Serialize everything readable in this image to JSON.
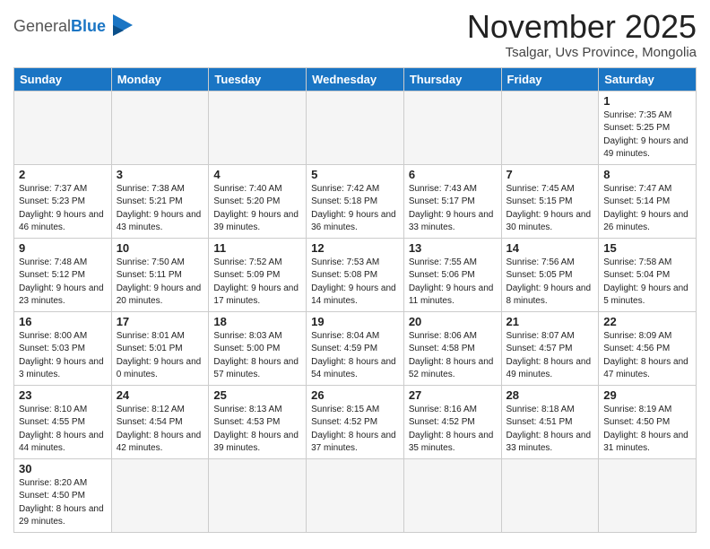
{
  "header": {
    "logo_general": "General",
    "logo_blue": "Blue",
    "month_title": "November 2025",
    "location": "Tsalgar, Uvs Province, Mongolia"
  },
  "weekdays": [
    "Sunday",
    "Monday",
    "Tuesday",
    "Wednesday",
    "Thursday",
    "Friday",
    "Saturday"
  ],
  "weeks": [
    [
      {
        "day": "",
        "info": ""
      },
      {
        "day": "",
        "info": ""
      },
      {
        "day": "",
        "info": ""
      },
      {
        "day": "",
        "info": ""
      },
      {
        "day": "",
        "info": ""
      },
      {
        "day": "",
        "info": ""
      },
      {
        "day": "1",
        "info": "Sunrise: 7:35 AM\nSunset: 5:25 PM\nDaylight: 9 hours and 49 minutes."
      }
    ],
    [
      {
        "day": "2",
        "info": "Sunrise: 7:37 AM\nSunset: 5:23 PM\nDaylight: 9 hours and 46 minutes."
      },
      {
        "day": "3",
        "info": "Sunrise: 7:38 AM\nSunset: 5:21 PM\nDaylight: 9 hours and 43 minutes."
      },
      {
        "day": "4",
        "info": "Sunrise: 7:40 AM\nSunset: 5:20 PM\nDaylight: 9 hours and 39 minutes."
      },
      {
        "day": "5",
        "info": "Sunrise: 7:42 AM\nSunset: 5:18 PM\nDaylight: 9 hours and 36 minutes."
      },
      {
        "day": "6",
        "info": "Sunrise: 7:43 AM\nSunset: 5:17 PM\nDaylight: 9 hours and 33 minutes."
      },
      {
        "day": "7",
        "info": "Sunrise: 7:45 AM\nSunset: 5:15 PM\nDaylight: 9 hours and 30 minutes."
      },
      {
        "day": "8",
        "info": "Sunrise: 7:47 AM\nSunset: 5:14 PM\nDaylight: 9 hours and 26 minutes."
      }
    ],
    [
      {
        "day": "9",
        "info": "Sunrise: 7:48 AM\nSunset: 5:12 PM\nDaylight: 9 hours and 23 minutes."
      },
      {
        "day": "10",
        "info": "Sunrise: 7:50 AM\nSunset: 5:11 PM\nDaylight: 9 hours and 20 minutes."
      },
      {
        "day": "11",
        "info": "Sunrise: 7:52 AM\nSunset: 5:09 PM\nDaylight: 9 hours and 17 minutes."
      },
      {
        "day": "12",
        "info": "Sunrise: 7:53 AM\nSunset: 5:08 PM\nDaylight: 9 hours and 14 minutes."
      },
      {
        "day": "13",
        "info": "Sunrise: 7:55 AM\nSunset: 5:06 PM\nDaylight: 9 hours and 11 minutes."
      },
      {
        "day": "14",
        "info": "Sunrise: 7:56 AM\nSunset: 5:05 PM\nDaylight: 9 hours and 8 minutes."
      },
      {
        "day": "15",
        "info": "Sunrise: 7:58 AM\nSunset: 5:04 PM\nDaylight: 9 hours and 5 minutes."
      }
    ],
    [
      {
        "day": "16",
        "info": "Sunrise: 8:00 AM\nSunset: 5:03 PM\nDaylight: 9 hours and 3 minutes."
      },
      {
        "day": "17",
        "info": "Sunrise: 8:01 AM\nSunset: 5:01 PM\nDaylight: 9 hours and 0 minutes."
      },
      {
        "day": "18",
        "info": "Sunrise: 8:03 AM\nSunset: 5:00 PM\nDaylight: 8 hours and 57 minutes."
      },
      {
        "day": "19",
        "info": "Sunrise: 8:04 AM\nSunset: 4:59 PM\nDaylight: 8 hours and 54 minutes."
      },
      {
        "day": "20",
        "info": "Sunrise: 8:06 AM\nSunset: 4:58 PM\nDaylight: 8 hours and 52 minutes."
      },
      {
        "day": "21",
        "info": "Sunrise: 8:07 AM\nSunset: 4:57 PM\nDaylight: 8 hours and 49 minutes."
      },
      {
        "day": "22",
        "info": "Sunrise: 8:09 AM\nSunset: 4:56 PM\nDaylight: 8 hours and 47 minutes."
      }
    ],
    [
      {
        "day": "23",
        "info": "Sunrise: 8:10 AM\nSunset: 4:55 PM\nDaylight: 8 hours and 44 minutes."
      },
      {
        "day": "24",
        "info": "Sunrise: 8:12 AM\nSunset: 4:54 PM\nDaylight: 8 hours and 42 minutes."
      },
      {
        "day": "25",
        "info": "Sunrise: 8:13 AM\nSunset: 4:53 PM\nDaylight: 8 hours and 39 minutes."
      },
      {
        "day": "26",
        "info": "Sunrise: 8:15 AM\nSunset: 4:52 PM\nDaylight: 8 hours and 37 minutes."
      },
      {
        "day": "27",
        "info": "Sunrise: 8:16 AM\nSunset: 4:52 PM\nDaylight: 8 hours and 35 minutes."
      },
      {
        "day": "28",
        "info": "Sunrise: 8:18 AM\nSunset: 4:51 PM\nDaylight: 8 hours and 33 minutes."
      },
      {
        "day": "29",
        "info": "Sunrise: 8:19 AM\nSunset: 4:50 PM\nDaylight: 8 hours and 31 minutes."
      }
    ],
    [
      {
        "day": "30",
        "info": "Sunrise: 8:20 AM\nSunset: 4:50 PM\nDaylight: 8 hours and 29 minutes."
      },
      {
        "day": "",
        "info": ""
      },
      {
        "day": "",
        "info": ""
      },
      {
        "day": "",
        "info": ""
      },
      {
        "day": "",
        "info": ""
      },
      {
        "day": "",
        "info": ""
      },
      {
        "day": "",
        "info": ""
      }
    ]
  ]
}
